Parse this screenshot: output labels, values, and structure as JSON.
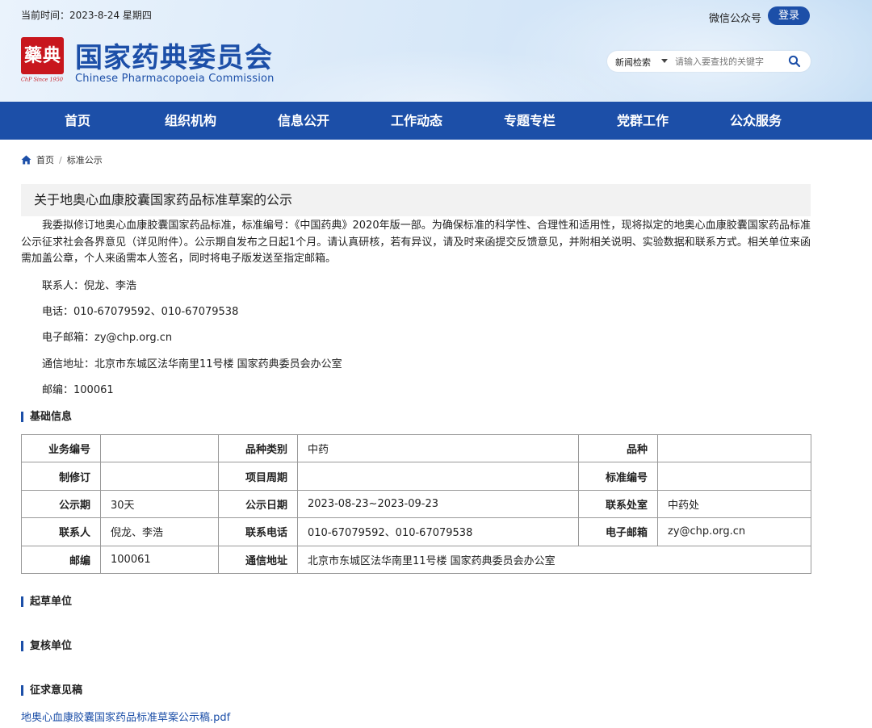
{
  "header": {
    "date": "当前时间：2023-8-24 星期四",
    "wechat": "微信公众号",
    "login": "登录",
    "seal_chars": [
      "藥",
      "典"
    ],
    "seal_sub": "ChP Since 1950",
    "title_cn": "国家药典委员会",
    "title_en": "Chinese Pharmacopoeia Commission",
    "brand_color": "#1c4fa8",
    "seal_color": "#c8161d"
  },
  "search": {
    "category": "新闻检索",
    "placeholder": "请输入要查找的关键字",
    "icon": "search-icon"
  },
  "nav": [
    "首页",
    "组织机构",
    "信息公开",
    "工作动态",
    "专题专栏",
    "党群工作",
    "公众服务"
  ],
  "breadcrumb": {
    "home": "首页",
    "sep": "/",
    "current": "标准公示",
    "icon": "home-icon"
  },
  "article": {
    "title": "关于地奥心血康胶囊国家药品标准草案的公示",
    "intro": "我委拟修订地奥心血康胶囊国家药品标准，标准编号：《中国药典》2020年版一部。为确保标准的科学性、合理性和适用性，现将拟定的地奥心血康胶囊国家药品标准公示征求社会各界意见（详见附件）。公示期自发布之日起1个月。请认真研核，若有异议，请及时来函提交反馈意见，并附相关说明、实验数据和联系方式。相关单位来函需加盖公章，个人来函需本人签名，同时将电子版发送至指定邮箱。",
    "contacts": [
      "联系人：倪龙、李浩",
      "电话：010-67079592、010-67079538",
      "电子邮箱：zy@chp.org.cn",
      "通信地址：北京市东城区法华南里11号楼 国家药典委员会办公室",
      "邮编：100061"
    ]
  },
  "sections": {
    "basic": "基础信息",
    "draft": "起草单位",
    "review": "复核单位",
    "comment": "征求意见稿"
  },
  "table": {
    "r1": [
      "业务编号",
      "",
      "品种类别",
      "中药",
      "品种",
      ""
    ],
    "r2": [
      "制修订",
      "",
      "项目周期",
      "",
      "标准编号",
      ""
    ],
    "r3": [
      "公示期",
      "30天",
      "公示日期",
      "2023-08-23~2023-09-23",
      "联系处室",
      "中药处"
    ],
    "r4": [
      "联系人",
      "倪龙、李浩",
      "联系电话",
      "010-67079592、010-67079538",
      "电子邮箱",
      "zy@chp.org.cn"
    ],
    "r5": [
      "邮编",
      "100061",
      "通信地址",
      "北京市东城区法华南里11号楼 国家药典委员会办公室"
    ]
  },
  "attachment": "地奥心血康胶囊国家药品标准草案公示稿.pdf"
}
